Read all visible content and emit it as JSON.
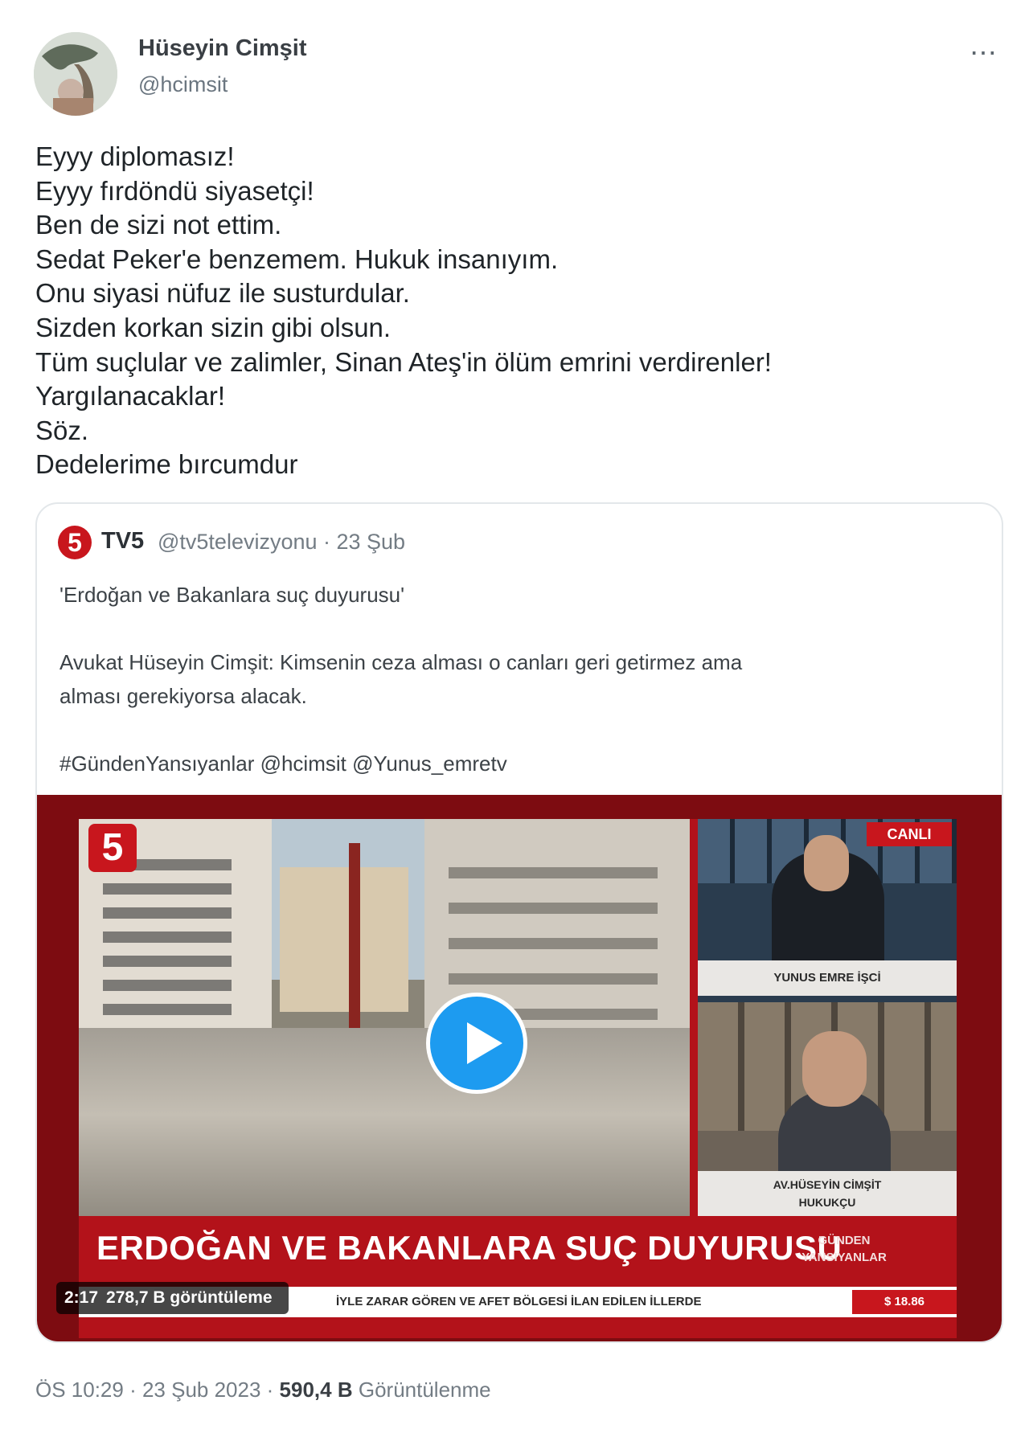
{
  "tweet": {
    "author_name": "Hüseyin Cimşit",
    "author_handle": "@hcimsit",
    "more_icon": "⋯",
    "lines": [
      "Eyyy diplomasız!",
      "Eyyy fırdöndü siyasetçi!",
      "Ben de sizi not ettim.",
      "Sedat Peker'e benzemem. Hukuk insanıyım.",
      "Onu siyasi nüfuz ile susturdular.",
      "Sizden korkan sizin gibi olsun.",
      "Tüm suçlular ve zalimler, Sinan Ateş'in ölüm emrini verdirenler!",
      "Yargılanacaklar!",
      "Söz.",
      "Dedelerime bırcumdur"
    ],
    "timestamp": "ÖS 10:29 · 23 Şub 2023 ·",
    "views_count": "590,4 B",
    "views_label": "Görüntülenme"
  },
  "quote": {
    "logo_glyph": "5",
    "name": "TV5",
    "meta": "@tv5televizyonu · 23 Şub",
    "lines": [
      "'Erdoğan ve Bakanlara suç duyurusu'",
      "",
      "Avukat Hüseyin Cimşit: Kimsenin ceza alması o canları geri getirmez ama",
      "alması gerekiyorsa alacak.",
      "",
      "#GündenYansıyanlar @hcimsit @Yunus_emretv"
    ]
  },
  "video": {
    "channel_logo": "5",
    "live_tag": "CANLI",
    "anchor_caption": "YUNUS EMRE İŞCİ",
    "guest_caption_1": "AV.HÜSEYİN CİMŞİT",
    "guest_caption_2": "HUKUKÇU",
    "headline": "ERDOĞAN VE BAKANLARA SUÇ DUYURUSU",
    "program_1": "GÜNDEN",
    "program_2": "YANSIYANLAR",
    "ticker": "İYLE ZARAR GÖREN VE AFET BÖLGESİ İLAN EDİLEN İLLERDE",
    "ticker_rate": "$  18.86",
    "duration": "2:17",
    "views": "278,7 B görüntüleme"
  },
  "colors": {
    "accent_play": "#1d9bf0",
    "tv5_red": "#c8161d"
  }
}
